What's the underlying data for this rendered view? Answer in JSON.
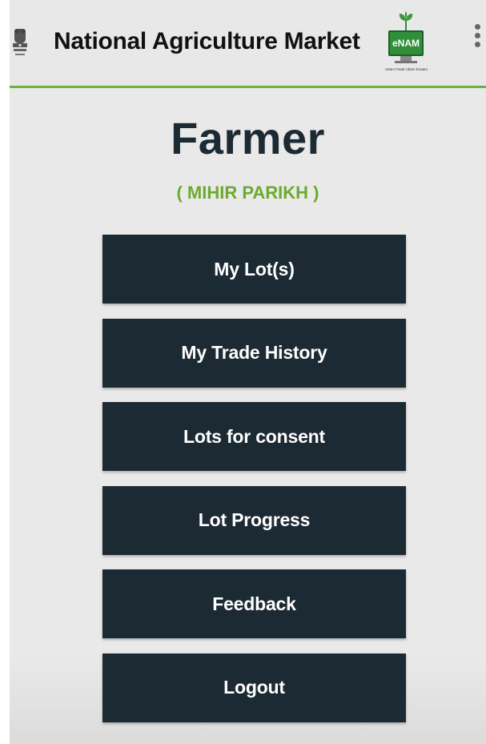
{
  "header": {
    "title": "National Agriculture Market",
    "emblem_icon": "state-emblem-icon",
    "logo": {
      "brand": "eNAM",
      "tagline": "Uttam Fasal Uttam Enaam"
    },
    "menu_icon": "overflow-menu-icon"
  },
  "profile": {
    "role": "Farmer",
    "name": "( MIHIR PARIKH )"
  },
  "menu": {
    "items": [
      {
        "label": "My Lot(s)"
      },
      {
        "label": "My Trade History"
      },
      {
        "label": "Lots for consent"
      },
      {
        "label": "Lot Progress"
      },
      {
        "label": "Feedback"
      },
      {
        "label": "Logout"
      }
    ]
  },
  "colors": {
    "accent_green": "#6cab2e",
    "header_rule": "#6cb33f",
    "button_bg": "#1c2a33",
    "title_text": "#1c2a33"
  }
}
